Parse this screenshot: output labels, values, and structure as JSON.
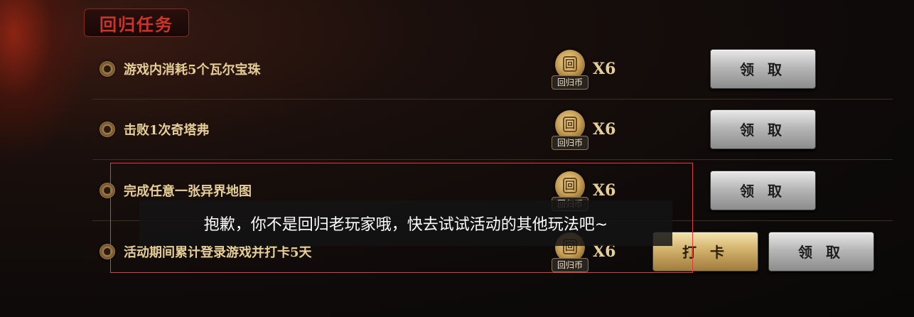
{
  "section": {
    "title": "回归任务"
  },
  "reward": {
    "coin_symbol": "回",
    "coin_label": "回归币",
    "coin_name": "coin-icon"
  },
  "tasks": [
    {
      "text": "游戏内消耗5个瓦尔宝珠",
      "qty": "X6",
      "claim_label": "领 取"
    },
    {
      "text": "击败1次奇塔弗",
      "qty": "X6",
      "claim_label": "领 取"
    },
    {
      "text": "完成任意一张异界地图",
      "qty": "X6",
      "claim_label": "领 取"
    },
    {
      "text": "活动期间累计登录游戏并打卡5天",
      "qty": "X6",
      "checkin_label": "打 卡",
      "claim_label": "领 取"
    }
  ],
  "toast": {
    "message": "抱歉，你不是回归老玩家哦，快去试试活动的其他玩法吧~"
  },
  "colors": {
    "accent_red": "#c9352a",
    "task_text": "#e6cf97",
    "gold": "#d2b16b",
    "frame_red": "#e23a3a"
  }
}
